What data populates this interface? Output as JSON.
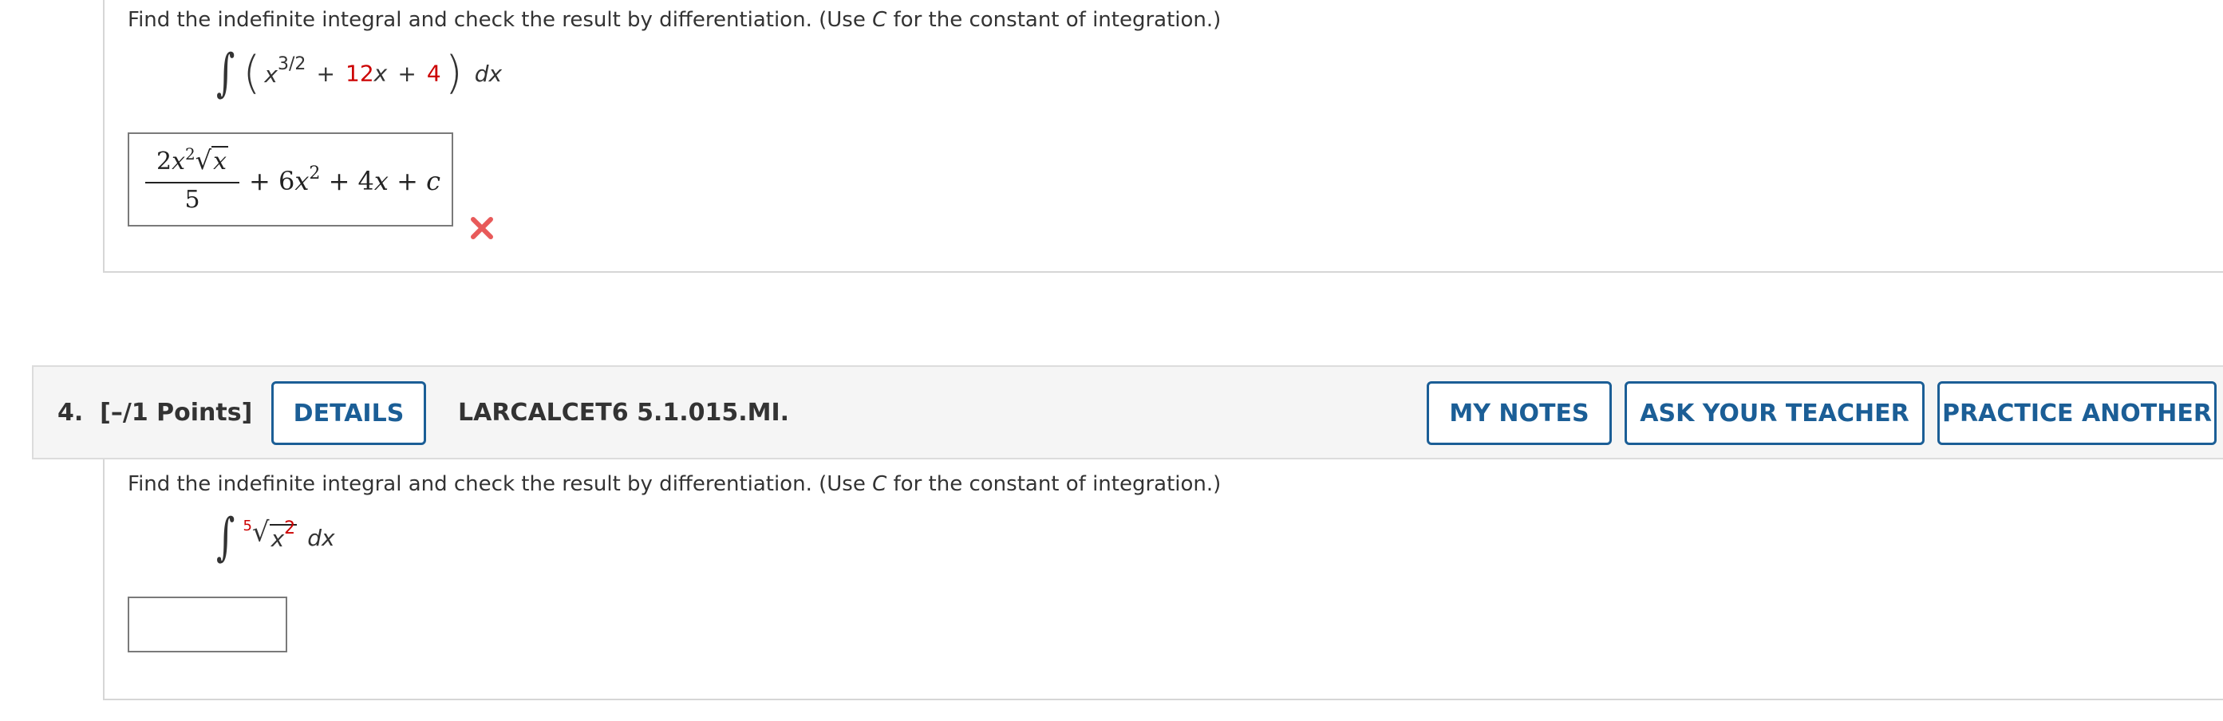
{
  "question3": {
    "prompt_before": "Find the indefinite integral and check the result by differentiation. (Use ",
    "prompt_var": "C",
    "prompt_after": " for the constant of integration.)",
    "integrand": {
      "base": "x",
      "exponent": "3/2",
      "plus1": "+",
      "coef": "12",
      "var": "x",
      "plus2": "+",
      "const": "4",
      "dx": "dx"
    },
    "answer": {
      "num_coef": "2",
      "num_var": "x",
      "num_exp": "2",
      "radicand": "x",
      "den": "5",
      "rest_1": "+ 6",
      "rest_var1": "x",
      "rest_exp": "2",
      "rest_2": " + 4",
      "rest_var2": "x",
      "rest_3": " + ",
      "rest_const": "c"
    },
    "status": "incorrect"
  },
  "question4": {
    "number": "4.",
    "points": "[–/1 Points]",
    "details_label": "DETAILS",
    "code": "LARCALCET6 5.1.015.MI.",
    "my_notes_label": "MY NOTES",
    "ask_teacher_label": "ASK YOUR TEACHER",
    "practice_label": "PRACTICE ANOTHER",
    "prompt_before": "Find the indefinite integral and check the result by differentiation. (Use ",
    "prompt_var": "C",
    "prompt_after": " for the constant of integration.)",
    "integrand": {
      "root_index": "5",
      "base": "x",
      "exponent": "2",
      "dx": "dx"
    },
    "answer_value": ""
  },
  "colors": {
    "accent": "#1b5e96",
    "highlight": "#cc0000",
    "wrong_mark": "#e85a5a",
    "header_band": "#f5f5f5"
  }
}
